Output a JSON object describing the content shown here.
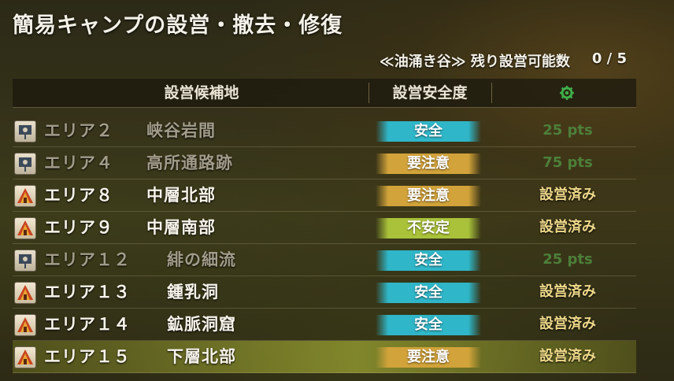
{
  "title": "簡易キャンプの設営・撤去・修復",
  "remaining": {
    "label": "≪油涌き谷≫ 残り設営可能数",
    "count": "0 / 5"
  },
  "columns": {
    "site": "設営候補地",
    "safety": "設営安全度",
    "status_icon": "gear-icon"
  },
  "colors": {
    "safe": "#2fb6c8",
    "caution": "#d2a33a",
    "unstable": "#a9c23a",
    "points": "#4d7f3a",
    "built": "#efd98a",
    "selected_row": "#bfc840"
  },
  "rows": [
    {
      "area": "エリア２",
      "place": "峡谷岩間",
      "safety": "安全",
      "safety_level": "safe",
      "status": "25 pts",
      "state": "available",
      "icon": "flag-icon"
    },
    {
      "area": "エリア４",
      "place": "高所通路跡",
      "safety": "要注意",
      "safety_level": "caution",
      "status": "75 pts",
      "state": "available",
      "icon": "flag-icon"
    },
    {
      "area": "エリア８",
      "place": "中層北部",
      "safety": "要注意",
      "safety_level": "caution",
      "status": "設営済み",
      "state": "built",
      "icon": "tent-icon"
    },
    {
      "area": "エリア９",
      "place": "中層南部",
      "safety": "不安定",
      "safety_level": "unstable",
      "status": "設営済み",
      "state": "built",
      "icon": "tent-icon"
    },
    {
      "area": "エリア１２",
      "place": "緋の細流",
      "safety": "安全",
      "safety_level": "safe",
      "status": "25 pts",
      "state": "available",
      "icon": "flag-icon"
    },
    {
      "area": "エリア１３",
      "place": "鍾乳洞",
      "safety": "安全",
      "safety_level": "safe",
      "status": "設営済み",
      "state": "built",
      "icon": "tent-icon"
    },
    {
      "area": "エリア１４",
      "place": "鉱脈洞窟",
      "safety": "安全",
      "safety_level": "safe",
      "status": "設営済み",
      "state": "built",
      "icon": "tent-icon"
    },
    {
      "area": "エリア１５",
      "place": "下層北部",
      "safety": "要注意",
      "safety_level": "caution",
      "status": "設営済み",
      "state": "built",
      "icon": "tent-icon",
      "selected": true
    }
  ]
}
